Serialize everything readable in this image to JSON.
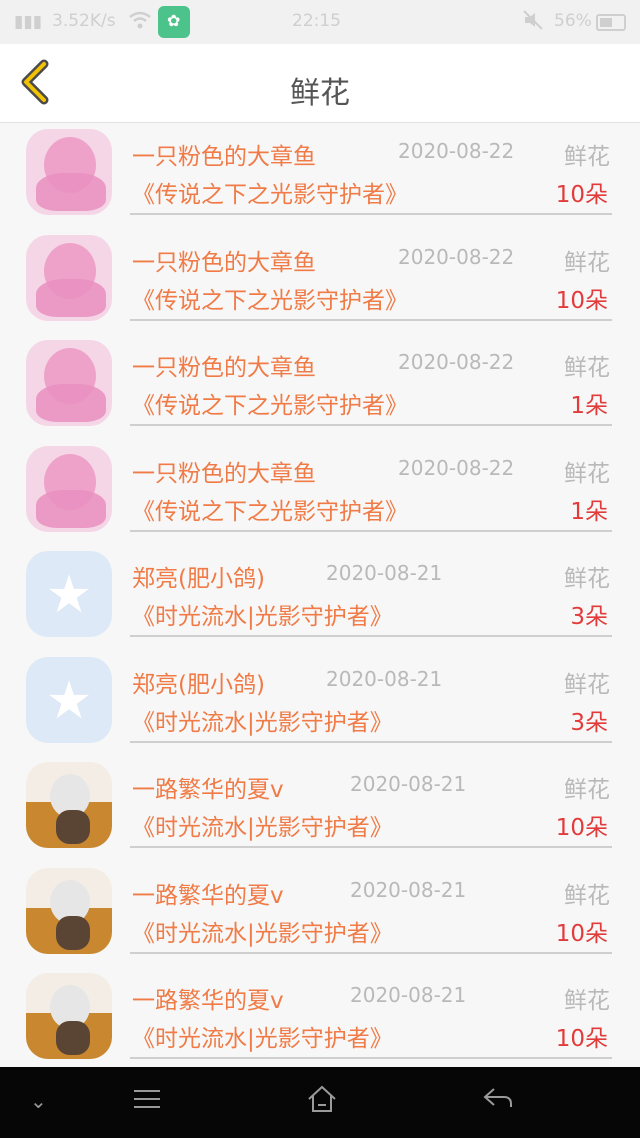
{
  "status_bar": {
    "signal": "▮▮▮",
    "speed": "3.52K/s",
    "time": "22:15",
    "battery": "56%",
    "icons": [
      "signal-icon",
      "wifi-icon",
      "app-icon",
      "mute-icon",
      "battery-icon"
    ]
  },
  "header": {
    "title": "鲜花"
  },
  "list": [
    {
      "avatar": "pink",
      "name": "一只粉色的大章鱼",
      "date": "2020-08-22",
      "gift_label": "鲜花",
      "book": "《传说之下之光影守护者》",
      "count": "10朵"
    },
    {
      "avatar": "pink",
      "name": "一只粉色的大章鱼",
      "date": "2020-08-22",
      "gift_label": "鲜花",
      "book": "《传说之下之光影守护者》",
      "count": "10朵"
    },
    {
      "avatar": "pink",
      "name": "一只粉色的大章鱼",
      "date": "2020-08-22",
      "gift_label": "鲜花",
      "book": "《传说之下之光影守护者》",
      "count": "1朵"
    },
    {
      "avatar": "pink",
      "name": "一只粉色的大章鱼",
      "date": "2020-08-22",
      "gift_label": "鲜花",
      "book": "《传说之下之光影守护者》",
      "count": "1朵"
    },
    {
      "avatar": "qq",
      "name": "郑亮(肥小鸽)",
      "date": "2020-08-21",
      "gift_label": "鲜花",
      "book": "《时光流水|光影守护者》",
      "count": "3朵"
    },
    {
      "avatar": "qq",
      "name": "郑亮(肥小鸽)",
      "date": "2020-08-21",
      "gift_label": "鲜花",
      "book": "《时光流水|光影守护者》",
      "count": "3朵"
    },
    {
      "avatar": "warm",
      "name": "一路繁华的夏v",
      "date": "2020-08-21",
      "gift_label": "鲜花",
      "book": "《时光流水|光影守护者》",
      "count": "10朵"
    },
    {
      "avatar": "warm",
      "name": "一路繁华的夏v",
      "date": "2020-08-21",
      "gift_label": "鲜花",
      "book": "《时光流水|光影守护者》",
      "count": "10朵"
    },
    {
      "avatar": "warm",
      "name": "一路繁华的夏v",
      "date": "2020-08-21",
      "gift_label": "鲜花",
      "book": "《时光流水|光影守护者》",
      "count": "10朵"
    }
  ],
  "colors": {
    "accent": "#f07b46",
    "count": "#e23b3b",
    "muted": "#b9b9b9",
    "back_icon": "#f2c200"
  }
}
